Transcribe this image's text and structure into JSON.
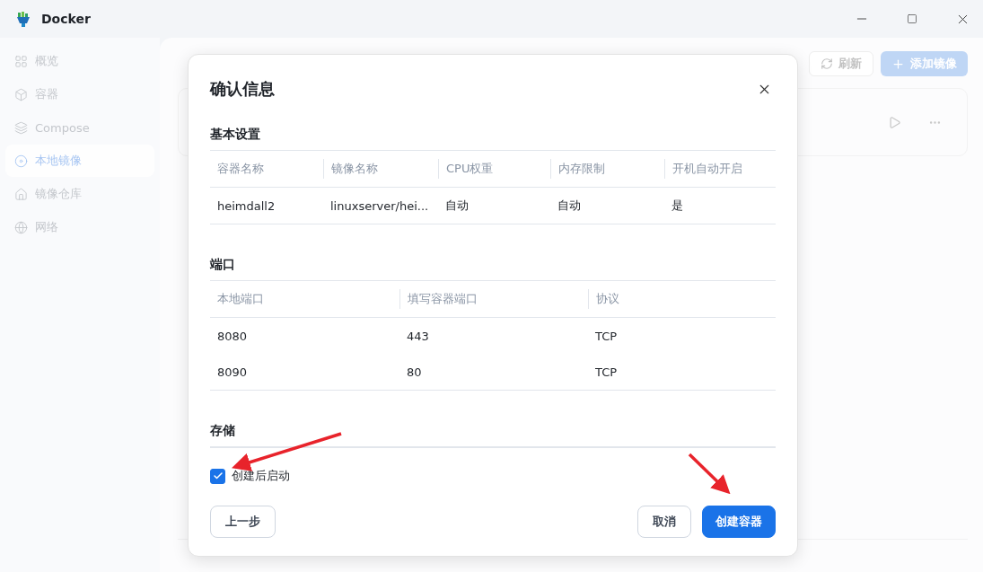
{
  "window": {
    "title": "Docker"
  },
  "sidebar": {
    "items": [
      {
        "label": "概览",
        "selected": false
      },
      {
        "label": "容器",
        "selected": false
      },
      {
        "label": "Compose",
        "selected": false
      },
      {
        "label": "本地镜像",
        "selected": true
      },
      {
        "label": "镜像仓库",
        "selected": false
      },
      {
        "label": "网络",
        "selected": false
      }
    ]
  },
  "page": {
    "refresh_button": "刷新",
    "add_button": "添加镜像"
  },
  "dialog": {
    "title": "确认信息",
    "sections": [
      {
        "title": "基本设置",
        "kind": "table",
        "columns": [
          "容器名称",
          "镜像名称",
          "CPU权重",
          "内存限制",
          "开机自动开启"
        ],
        "rows": [
          [
            "heimdall2",
            "linuxserver/hei...",
            "自动",
            "自动",
            "是"
          ]
        ]
      },
      {
        "title": "端口",
        "kind": "table",
        "columns": [
          "本地端口",
          "填写容器端口",
          "协议"
        ],
        "rows": [
          [
            "8080",
            "443",
            "TCP"
          ],
          [
            "8090",
            "80",
            "TCP"
          ]
        ]
      },
      {
        "title": "存储",
        "kind": "empty"
      }
    ],
    "start_after_create": {
      "label": "创建后启动",
      "checked": true
    },
    "buttons": {
      "back": "上一步",
      "cancel": "取消",
      "create": "创建容器"
    }
  }
}
